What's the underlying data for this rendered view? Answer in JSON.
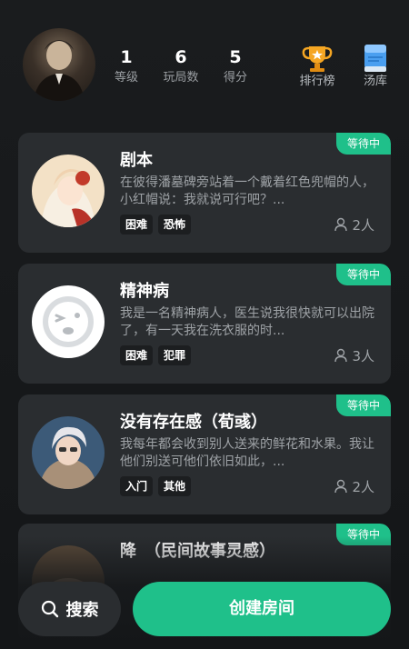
{
  "profile": {
    "stats": [
      {
        "value": "1",
        "label": "等级"
      },
      {
        "value": "6",
        "label": "玩局数"
      },
      {
        "value": "5",
        "label": "得分"
      }
    ],
    "ranking_label": "排行榜",
    "library_label": "汤库",
    "icons": {
      "ranking": "trophy-icon",
      "library": "book-icon"
    }
  },
  "rooms": [
    {
      "status": "等待中",
      "title": "剧本",
      "description": "在彼得潘墓碑旁站着一个戴着红色兜帽的人，小红帽说：我就说可行吧？...",
      "tags": [
        "困难",
        "恐怖"
      ],
      "players": "2人"
    },
    {
      "status": "等待中",
      "title": "精神病",
      "description": "我是一名精神病人，医生说我很快就可以出院了，有一天我在洗衣服的时...",
      "tags": [
        "困难",
        "犯罪"
      ],
      "players": "3人"
    },
    {
      "status": "等待中",
      "title": "没有存在感（荀彧）",
      "description": "我每年都会收到别人送来的鲜花和水果。我让他们别送可他们依旧如此，...",
      "tags": [
        "入门",
        "其他"
      ],
      "players": "2人"
    },
    {
      "status": "等待中",
      "title": "降　（民间故事灵感）",
      "description": "",
      "tags": [],
      "players": ""
    }
  ],
  "bottom": {
    "search_label": "搜索",
    "create_label": "创建房间"
  },
  "colors": {
    "accent": "#1fc08a",
    "card": "#2a2d30",
    "background": "#141618"
  }
}
